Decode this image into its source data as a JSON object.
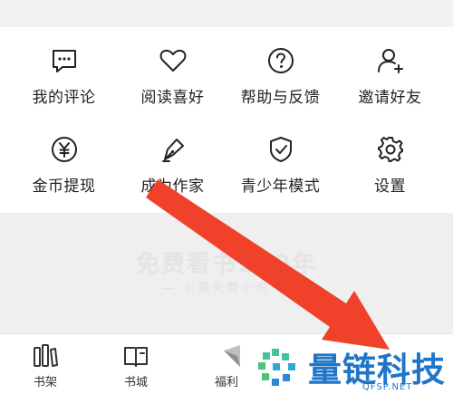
{
  "menu": {
    "row1": [
      {
        "label": "我的评论",
        "icon": "comment-icon"
      },
      {
        "label": "阅读喜好",
        "icon": "heart-icon"
      },
      {
        "label": "帮助与反馈",
        "icon": "help-icon"
      },
      {
        "label": "邀请好友",
        "icon": "add-user-icon"
      }
    ],
    "row2": [
      {
        "label": "金币提现",
        "icon": "coin-yuan-icon"
      },
      {
        "label": "成为作家",
        "icon": "pen-nib-icon"
      },
      {
        "label": "青少年模式",
        "icon": "shield-check-icon"
      },
      {
        "label": "设置",
        "icon": "gear-icon"
      }
    ]
  },
  "banner": {
    "title": "免费看书100年",
    "subtitle": "— 七猫免费小说 —"
  },
  "tabbar": {
    "items": [
      {
        "label": "书架",
        "icon": "bookshelf-icon"
      },
      {
        "label": "书城",
        "icon": "book-icon"
      },
      {
        "label": "福利",
        "icon": "gift-icon"
      }
    ]
  },
  "annotation": {
    "color": "#f0422b"
  },
  "watermark": {
    "name": "量链科技",
    "url": "QFSP.NET",
    "color": "#1f75c8"
  }
}
